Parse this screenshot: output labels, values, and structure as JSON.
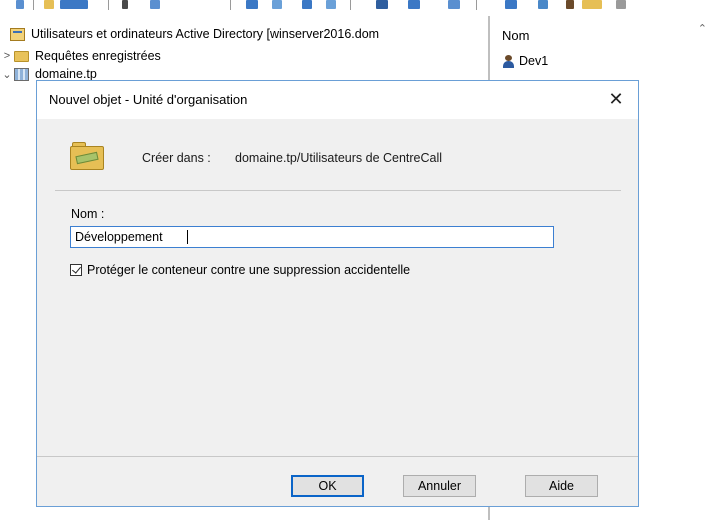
{
  "tree": {
    "root_label": "Utilisateurs et ordinateurs Active Directory [winserver2016.dom",
    "items": [
      {
        "label": "Requêtes enregistrées",
        "chevron": ">"
      },
      {
        "label": "domaine.tp",
        "chevron": "⌄"
      }
    ]
  },
  "list": {
    "column_header": "Nom",
    "items": [
      "Dev1"
    ]
  },
  "dialog": {
    "title": "Nouvel objet - Unité d'organisation",
    "close_glyph": "✕",
    "create_in_label": "Créer dans :",
    "create_in_path": "domaine.tp/Utilisateurs de CentreCall",
    "name_label": "Nom :",
    "name_value": "Développement",
    "protect_label": "Protéger le conteneur contre une suppression accidentelle",
    "protect_checked": true,
    "buttons": {
      "ok": "OK",
      "cancel": "Annuler",
      "help": "Aide"
    }
  },
  "icons": {
    "ou": "organizational-unit-icon",
    "folder": "folder-icon",
    "domain": "domain-icon",
    "user": "user-icon"
  },
  "colors": {
    "accent": "#0a64c8",
    "dialog_bg": "#f0f0f0",
    "input_border": "#3c7fd1"
  }
}
